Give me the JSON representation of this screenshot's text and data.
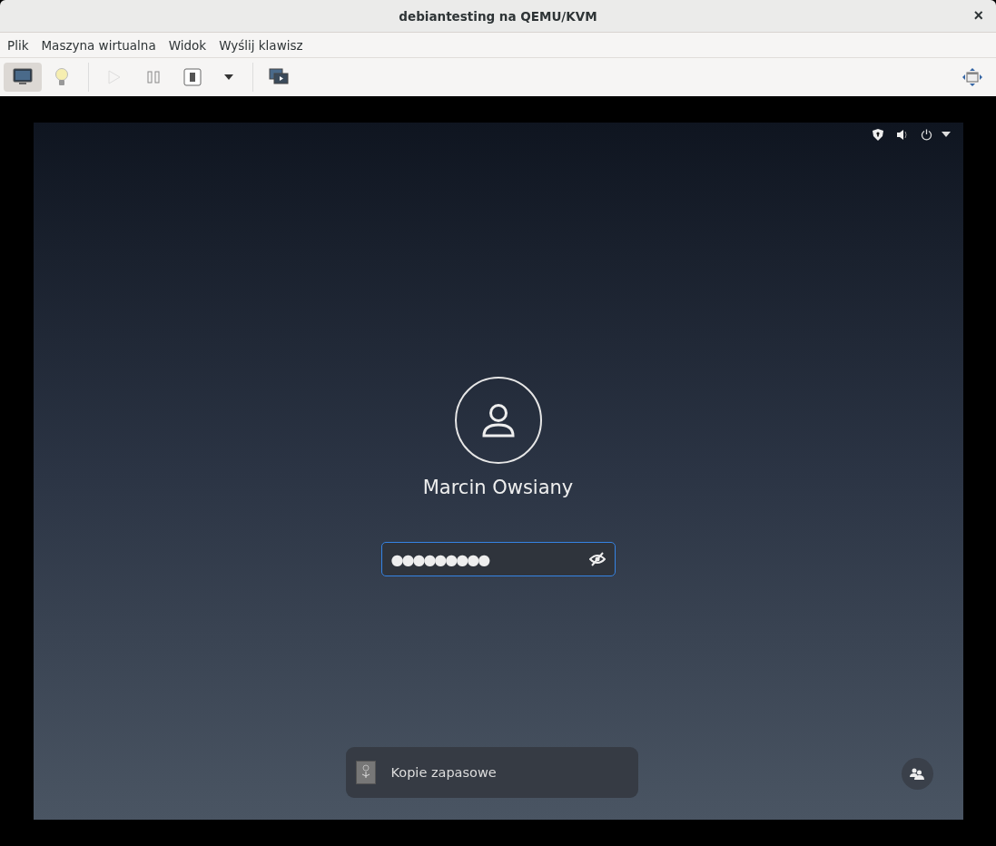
{
  "window": {
    "title": "debiantesting na QEMU/KVM",
    "close": "×"
  },
  "menu": [
    "Plik",
    "Maszyna wirtualna",
    "Widok",
    "Wyślij klawisz"
  ],
  "toolbar": [
    {
      "kind": "console",
      "selected": true,
      "disabled": false
    },
    {
      "kind": "details",
      "selected": false,
      "disabled": false
    },
    {
      "kind": "run",
      "selected": false,
      "disabled": true
    },
    {
      "kind": "pause",
      "selected": false,
      "disabled": false
    },
    {
      "kind": "shutdown",
      "selected": false,
      "disabled": false
    },
    {
      "kind": "menu",
      "selected": false,
      "disabled": false
    },
    {
      "kind": "snapshots",
      "selected": false,
      "disabled": false
    }
  ],
  "login": {
    "user_name": "Marcin Owsiany",
    "password": "●●●●●●●●●",
    "notification": "Kopie zapasowe"
  }
}
